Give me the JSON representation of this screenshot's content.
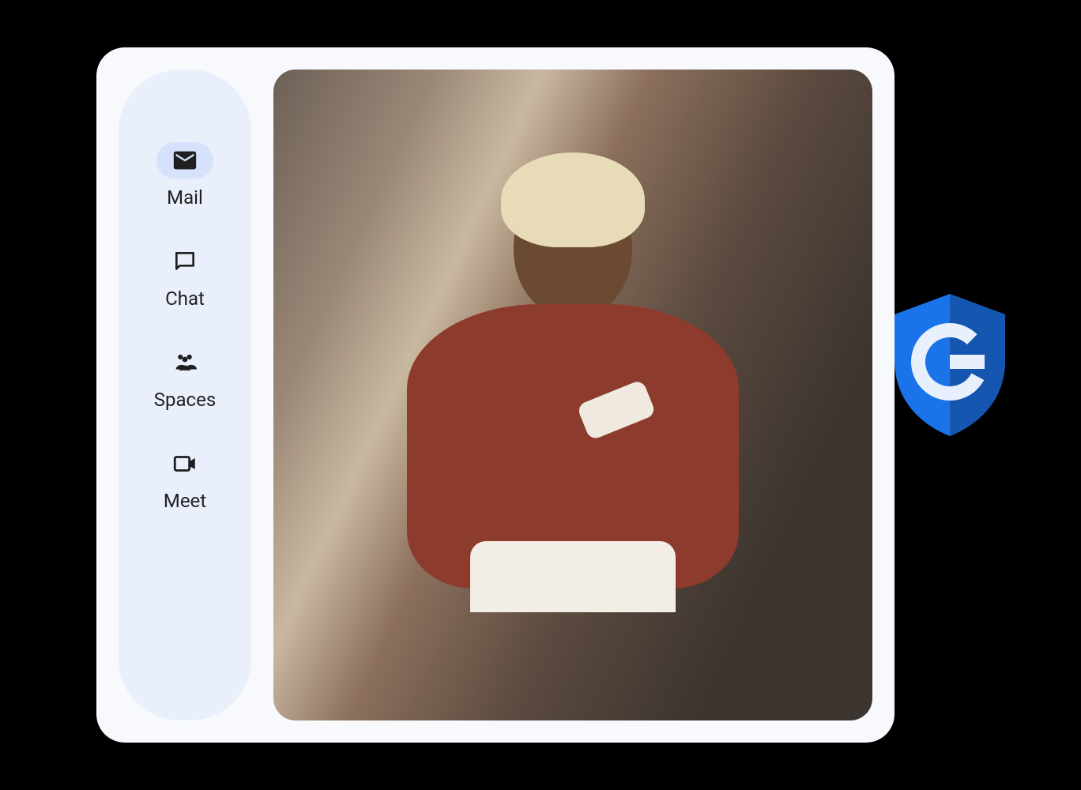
{
  "sidebar": {
    "items": [
      {
        "label": "Mail",
        "icon": "mail-icon",
        "active": true
      },
      {
        "label": "Chat",
        "icon": "chat-icon",
        "active": false
      },
      {
        "label": "Spaces",
        "icon": "spaces-icon",
        "active": false
      },
      {
        "label": "Meet",
        "icon": "meet-icon",
        "active": false
      }
    ]
  },
  "badge": {
    "name": "google-shield-icon",
    "letter": "G",
    "shield_color": "#1a73e8",
    "shield_shadow": "#1557b0",
    "letter_color": "#e8f0fe"
  },
  "content": {
    "description": "Person using a smartphone in an office setting"
  }
}
